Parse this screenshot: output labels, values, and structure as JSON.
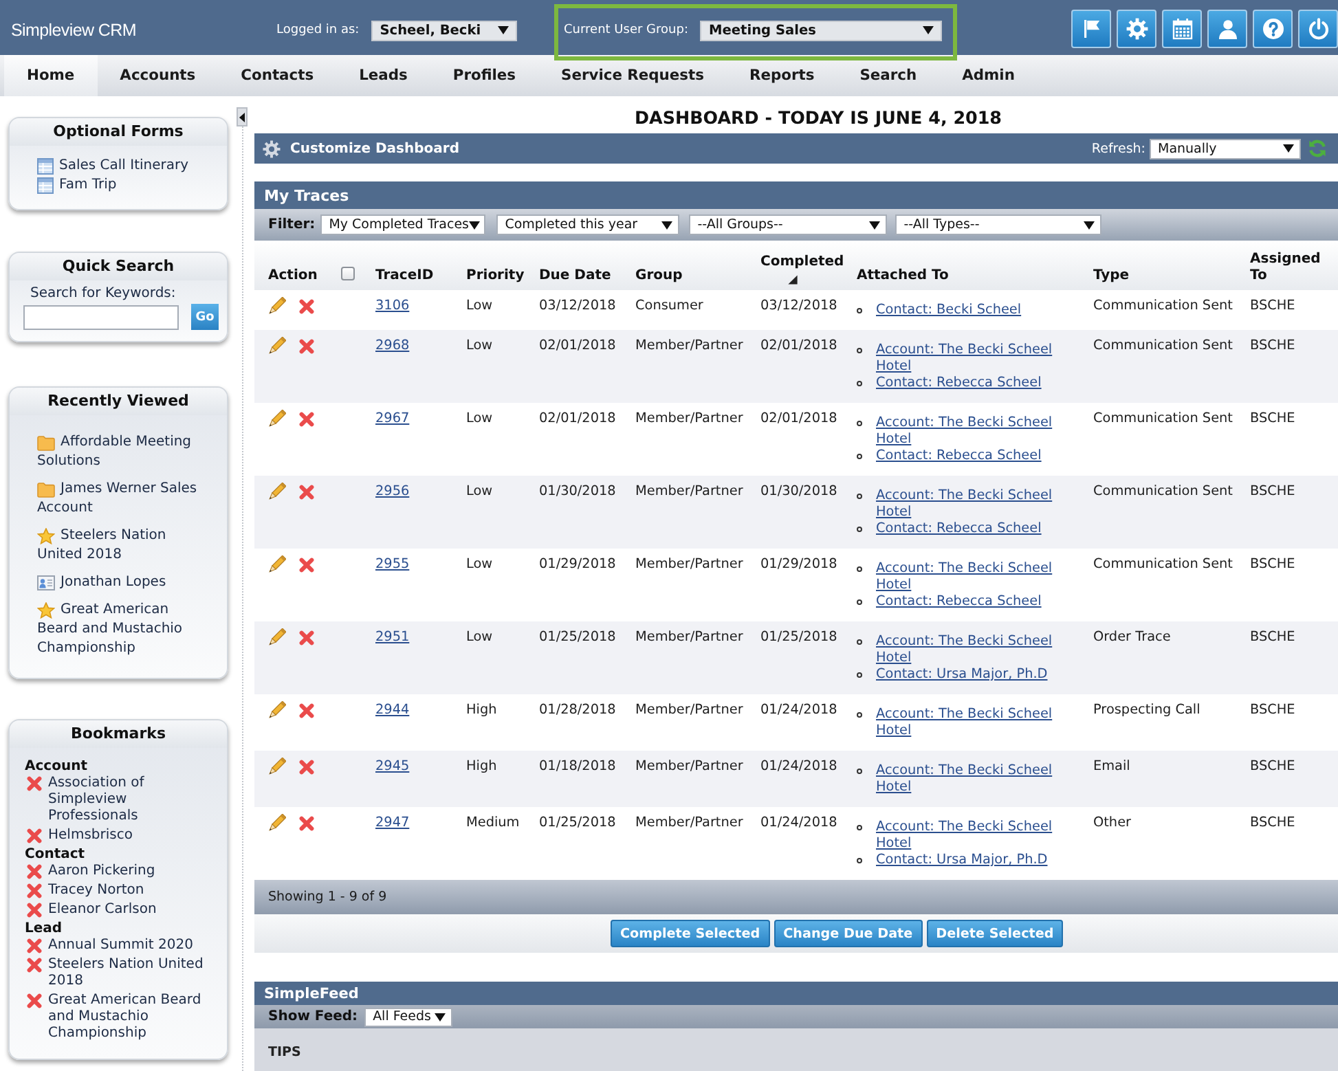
{
  "header": {
    "app_title": "Simpleview CRM",
    "logged_in_label": "Logged in as:",
    "user": "Scheel, Becki",
    "group_label": "Current User Group:",
    "group": "Meeting Sales",
    "group_highlighted": true
  },
  "nav": [
    {
      "label": "Home",
      "selected": true
    },
    {
      "label": "Accounts",
      "selected": false
    },
    {
      "label": "Contacts",
      "selected": false
    },
    {
      "label": "Leads",
      "selected": false
    },
    {
      "label": "Profiles",
      "selected": false
    },
    {
      "label": "Service Requests",
      "selected": false
    },
    {
      "label": "Reports",
      "selected": false
    },
    {
      "label": "Search",
      "selected": false
    },
    {
      "label": "Admin",
      "selected": false
    }
  ],
  "sidebar": {
    "optional_forms": {
      "title": "Optional Forms",
      "items": [
        "Sales Call Itinerary",
        "Fam Trip"
      ]
    },
    "quick_search": {
      "title": "Quick Search",
      "label": "Search for Keywords:",
      "button": "Go"
    },
    "recently_viewed": {
      "title": "Recently Viewed",
      "items": [
        {
          "label": "Affordable Meeting Solutions",
          "kind": "folder"
        },
        {
          "label": "James Werner Sales Account",
          "kind": "folder"
        },
        {
          "label": "Steelers Nation United 2018",
          "kind": "star"
        },
        {
          "label": "Jonathan Lopes",
          "kind": "contact"
        },
        {
          "label": "Great American Beard and Mustachio Championship",
          "kind": "star"
        }
      ]
    },
    "bookmarks": {
      "title": "Bookmarks",
      "groups": [
        {
          "heading": "Account",
          "items": [
            "Association of Simpleview Professionals",
            "Helmsbrisco"
          ]
        },
        {
          "heading": "Contact",
          "items": [
            "Aaron Pickering",
            "Tracey Norton",
            "Eleanor Carlson"
          ]
        },
        {
          "heading": "Lead",
          "items": [
            "Annual Summit 2020",
            "Steelers Nation United 2018",
            "Great American Beard and Mustachio Championship"
          ]
        }
      ]
    }
  },
  "dashboard": {
    "title": "DASHBOARD - TODAY IS JUNE 4, 2018",
    "customize": "Customize Dashboard",
    "refresh_label": "Refresh:",
    "refresh_select": "Manually"
  },
  "traces": {
    "title": "My Traces",
    "filter_label": "Filter:",
    "filters": [
      "My Completed Traces",
      "Completed this year",
      "--All Groups--",
      "--All Types--"
    ],
    "select_all_checked": false,
    "columns": [
      {
        "label": "Action",
        "sorted": false
      },
      {
        "label": "TraceID",
        "sorted": false
      },
      {
        "label": "Priority",
        "sorted": false
      },
      {
        "label": "Due Date",
        "sorted": false
      },
      {
        "label": "Group",
        "sorted": false
      },
      {
        "label": "Completed",
        "sorted": true
      },
      {
        "label": "Attached To",
        "sorted": false
      },
      {
        "label": "Type",
        "sorted": false
      },
      {
        "label": "Assigned To",
        "sorted": false
      }
    ],
    "rows": [
      {
        "trace_id": "3106",
        "priority": "Low",
        "due_date": "03/12/2018",
        "group": "Consumer",
        "completed": "03/12/2018",
        "attached_to": [
          "Contact: Becki Scheel"
        ],
        "type": "Communication Sent",
        "assigned_to": "BSCHE"
      },
      {
        "trace_id": "2968",
        "priority": "Low",
        "due_date": "02/01/2018",
        "group": "Member/Partner",
        "completed": "02/01/2018",
        "attached_to": [
          "Account: The Becki Scheel Hotel",
          "Contact: Rebecca Scheel"
        ],
        "type": "Communication Sent",
        "assigned_to": "BSCHE"
      },
      {
        "trace_id": "2967",
        "priority": "Low",
        "due_date": "02/01/2018",
        "group": "Member/Partner",
        "completed": "02/01/2018",
        "attached_to": [
          "Account: The Becki Scheel Hotel",
          "Contact: Rebecca Scheel"
        ],
        "type": "Communication Sent",
        "assigned_to": "BSCHE"
      },
      {
        "trace_id": "2956",
        "priority": "Low",
        "due_date": "01/30/2018",
        "group": "Member/Partner",
        "completed": "01/30/2018",
        "attached_to": [
          "Account: The Becki Scheel Hotel",
          "Contact: Rebecca Scheel"
        ],
        "type": "Communication Sent",
        "assigned_to": "BSCHE"
      },
      {
        "trace_id": "2955",
        "priority": "Low",
        "due_date": "01/29/2018",
        "group": "Member/Partner",
        "completed": "01/29/2018",
        "attached_to": [
          "Account: The Becki Scheel Hotel",
          "Contact: Rebecca Scheel"
        ],
        "type": "Communication Sent",
        "assigned_to": "BSCHE"
      },
      {
        "trace_id": "2951",
        "priority": "Low",
        "due_date": "01/25/2018",
        "group": "Member/Partner",
        "completed": "01/25/2018",
        "attached_to": [
          "Account: The Becki Scheel Hotel",
          "Contact: Ursa Major, Ph.D"
        ],
        "type": "Order Trace",
        "assigned_to": "BSCHE"
      },
      {
        "trace_id": "2944",
        "priority": "High",
        "due_date": "01/28/2018",
        "group": "Member/Partner",
        "completed": "01/24/2018",
        "attached_to": [
          "Account: The Becki Scheel Hotel"
        ],
        "type": "Prospecting Call",
        "assigned_to": "BSCHE"
      },
      {
        "trace_id": "2945",
        "priority": "High",
        "due_date": "01/18/2018",
        "group": "Member/Partner",
        "completed": "01/24/2018",
        "attached_to": [
          "Account: The Becki Scheel Hotel"
        ],
        "type": "Email",
        "assigned_to": "BSCHE"
      },
      {
        "trace_id": "2947",
        "priority": "Medium",
        "due_date": "01/25/2018",
        "group": "Member/Partner",
        "completed": "01/24/2018",
        "attached_to": [
          "Account: The Becki Scheel Hotel",
          "Contact: Ursa Major, Ph.D"
        ],
        "type": "Other",
        "assigned_to": "BSCHE"
      }
    ],
    "footer": "Showing 1 - 9 of 9",
    "buttons": [
      "Complete Selected",
      "Change Due Date",
      "Delete Selected"
    ]
  },
  "simplefeed": {
    "title": "SimpleFeed",
    "show_feed_label": "Show Feed:",
    "feed_select": "All Feeds",
    "section_title": "TIPS"
  }
}
